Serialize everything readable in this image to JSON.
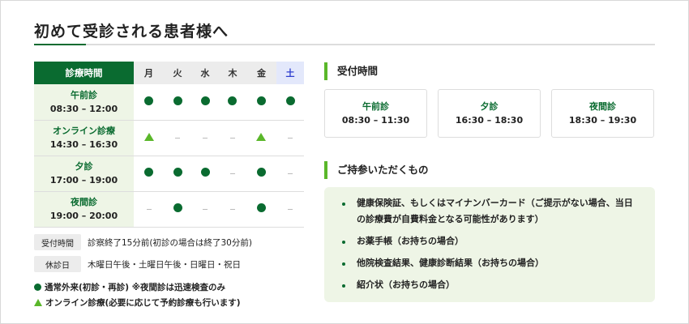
{
  "title": "初めて受診される患者様へ",
  "schedule": {
    "header": "診療時間",
    "days": [
      "月",
      "火",
      "水",
      "木",
      "金",
      "土"
    ],
    "rows": [
      {
        "name": "午前診",
        "time": "08:30 – 12:00",
        "marks": [
          "dot",
          "dot",
          "dot",
          "dot",
          "dot",
          "dot"
        ]
      },
      {
        "name": "オンライン診療",
        "time": "14:30 – 16:30",
        "marks": [
          "tri",
          "dash",
          "dash",
          "dash",
          "tri",
          "dash"
        ]
      },
      {
        "name": "夕診",
        "time": "17:00 – 19:00",
        "marks": [
          "dot",
          "dot",
          "dot",
          "dash",
          "dot",
          "dash"
        ]
      },
      {
        "name": "夜間診",
        "time": "19:00 – 20:00",
        "marks": [
          "dash",
          "dot",
          "dash",
          "dash",
          "dot",
          "dash"
        ]
      }
    ]
  },
  "info": [
    {
      "label": "受付時間",
      "text": "診察終了15分前(初診の場合は終了30分前)"
    },
    {
      "label": "休診日",
      "text": "木曜日午後・土曜日午後・日曜日・祝日"
    }
  ],
  "legend": [
    {
      "icon": "dot",
      "text": "通常外来(初診・再診) ※夜間診は迅速検査のみ"
    },
    {
      "icon": "tri",
      "text": "オンライン診療(必要に応じて予約診療も行います)"
    }
  ],
  "reception": {
    "heading": "受付時間",
    "cards": [
      {
        "name": "午前診",
        "time": "08:30 – 11:30"
      },
      {
        "name": "夕診",
        "time": "16:30 – 18:30"
      },
      {
        "name": "夜間診",
        "time": "18:30 – 19:30"
      }
    ]
  },
  "bring": {
    "heading": "ご持参いただくもの",
    "items": [
      "健康保険証、もしくはマイナンバーカード（ご提示がない場合、当日の診療費が自費料金となる可能性があります）",
      "お薬手帳（お持ちの場合）",
      "他院検査結果、健康診断結果（お持ちの場合）",
      "紹介状（お持ちの場合）"
    ]
  },
  "colors": {
    "green": "#0a6b30",
    "light_green": "#5ab72a",
    "bg_green": "#eef5e6",
    "saturday": "#2f3fcf"
  }
}
